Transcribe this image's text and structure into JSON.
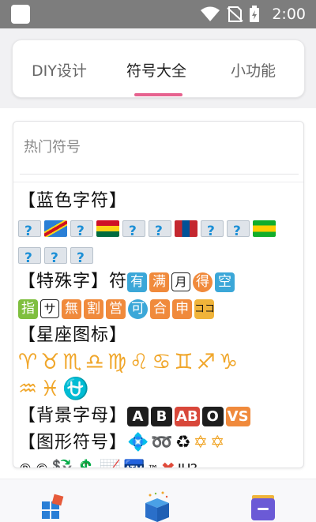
{
  "statusbar": {
    "time": "2:00"
  },
  "tabs": [
    {
      "label": "DIY设计",
      "active": false
    },
    {
      "label": "符号大全",
      "active": true
    },
    {
      "label": "小功能",
      "active": false
    }
  ],
  "card": {
    "title": "热门符号",
    "sections": {
      "blue": "【蓝色字符】",
      "special": "【特殊字】符",
      "zodiac": "【星座图标】",
      "letters": "【背景字母】",
      "shapes": "【图形符号】"
    },
    "special_badges": [
      "有",
      "满",
      "月",
      "得",
      "空",
      "指",
      "サ",
      "無",
      "割",
      "営",
      "可",
      "合",
      "申",
      "ココ"
    ],
    "zodiac_row1": "♈♉♏♎♍♌♋♊♐♑",
    "zodiac_row2": "♒♓⛎",
    "letter_badges": [
      "A",
      "B",
      "AB",
      "O",
      "VS"
    ],
    "shape_symbols": [
      "💠",
      "➿",
      "♻",
      "✡",
      "✡"
    ],
    "misc_symbols": [
      "®",
      "©",
      "💱",
      "💲",
      "📈",
      "🏧",
      "™",
      "✖",
      "‼",
      "⁉"
    ]
  },
  "colors": {
    "accent": "#e6628f",
    "statusbar": "#7d7d7d",
    "zodiac": "#f0a62a"
  }
}
